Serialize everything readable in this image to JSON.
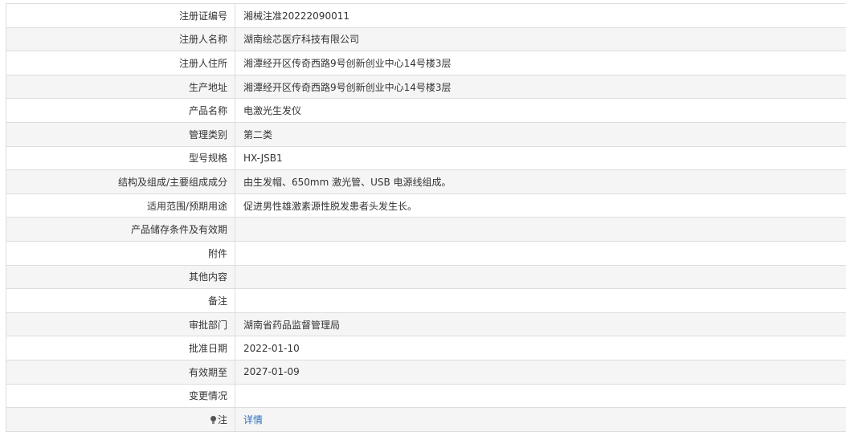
{
  "rows": [
    {
      "label": "注册证编号",
      "value": "湘械注准20222090011"
    },
    {
      "label": "注册人名称",
      "value": "湖南绘芯医疗科技有限公司"
    },
    {
      "label": "注册人住所",
      "value": "湘潭经开区传奇西路9号创新创业中心14号楼3层"
    },
    {
      "label": "生产地址",
      "value": "湘潭经开区传奇西路9号创新创业中心14号楼3层"
    },
    {
      "label": "产品名称",
      "value": "电激光生发仪"
    },
    {
      "label": "管理类别",
      "value": "第二类"
    },
    {
      "label": "型号规格",
      "value": "HX-JSB1"
    },
    {
      "label": "结构及组成/主要组成成分",
      "value": "由生发帽、650mm 激光管、USB 电源线组成。"
    },
    {
      "label": "适用范围/预期用途",
      "value": "促进男性雄激素源性脱发患者头发生长。"
    },
    {
      "label": "产品储存条件及有效期",
      "value": ""
    },
    {
      "label": "附件",
      "value": ""
    },
    {
      "label": "其他内容",
      "value": ""
    },
    {
      "label": "备注",
      "value": ""
    },
    {
      "label": "审批部门",
      "value": "湖南省药品监督管理局"
    },
    {
      "label": "批准日期",
      "value": "2022-01-10"
    },
    {
      "label": "有效期至",
      "value": "2027-01-09"
    },
    {
      "label": "变更情况",
      "value": ""
    }
  ],
  "note_row": {
    "icon": "lightbulb-icon",
    "label": "注",
    "link_text": "详情",
    "link_color": "#2a6ebb"
  }
}
